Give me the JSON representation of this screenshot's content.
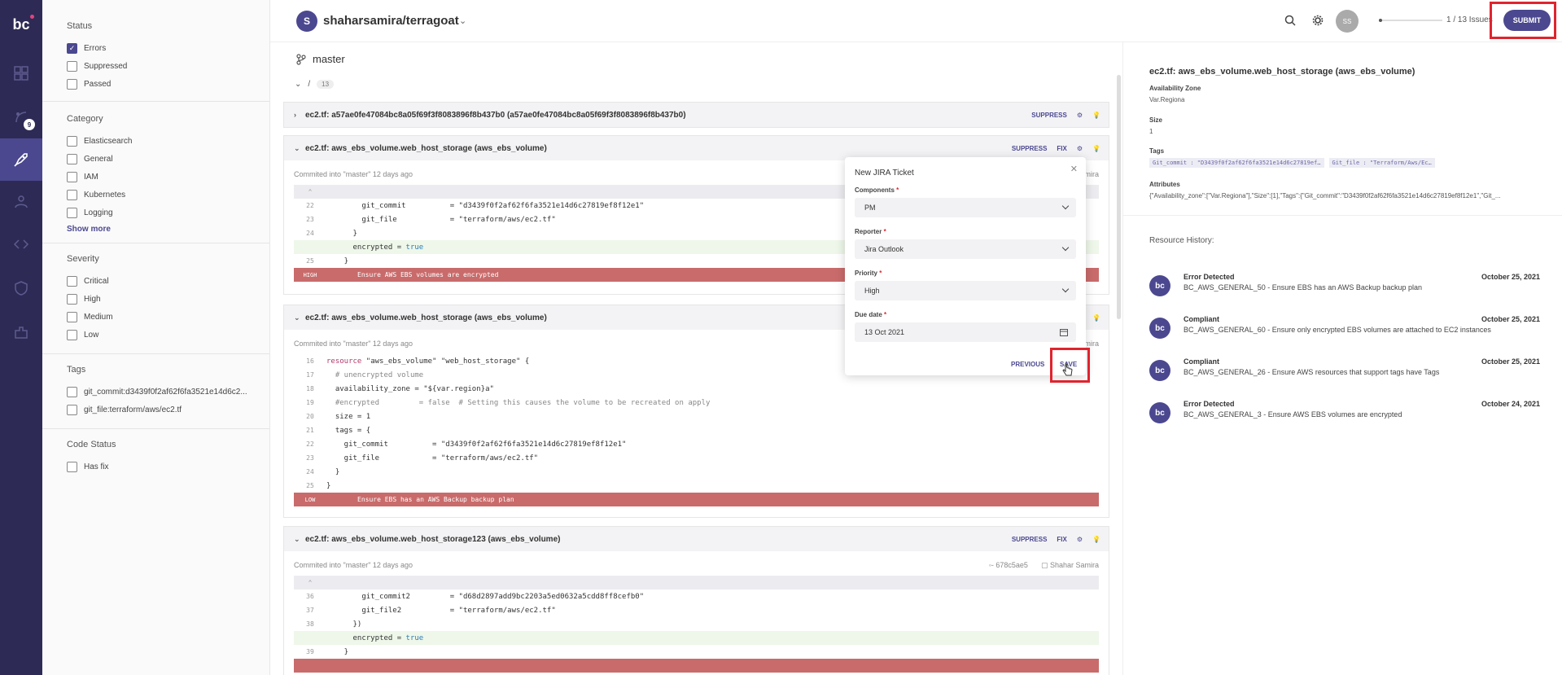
{
  "rail": {
    "logo": "bc",
    "badge_count": "9"
  },
  "filters": {
    "status": {
      "title": "Status",
      "items": [
        {
          "label": "Errors",
          "checked": true
        },
        {
          "label": "Suppressed",
          "checked": false
        },
        {
          "label": "Passed",
          "checked": false
        }
      ]
    },
    "category": {
      "title": "Category",
      "items": [
        "Elasticsearch",
        "General",
        "IAM",
        "Kubernetes",
        "Logging"
      ],
      "show_more": "Show more"
    },
    "severity": {
      "title": "Severity",
      "items": [
        "Critical",
        "High",
        "Medium",
        "Low"
      ]
    },
    "tags": {
      "title": "Tags",
      "items": [
        "git_commit:d3439f0f2af62f6fa3521e14d6c2...",
        "git_file:terraform/aws/ec2.tf"
      ]
    },
    "code_status": {
      "title": "Code Status",
      "items": [
        "Has fix"
      ]
    }
  },
  "topbar": {
    "repo_initial": "S",
    "repo_name": "shaharsamira/terragoat",
    "user_initials": "SS",
    "progress_fraction": 0.05,
    "issue_count": "1 / 13 Issues",
    "submit_label": "SUBMIT"
  },
  "main": {
    "branch": "master",
    "path_sep": "/",
    "path_count": "13",
    "blocks": [
      {
        "title": "ec2.tf: a57ae0fe47084bc8a05f69f3f8083896f8b437b0 (a57ae0fe47084bc8a05f69f3f8083896f8b437b0)",
        "suppress": "SUPPRESS"
      },
      {
        "title": "ec2.tf: aws_ebs_volume.web_host_storage (aws_ebs_volume)",
        "suppress": "SUPPRESS",
        "fix": "FIX",
        "commit": "Commited into \"master\" 12 days ago",
        "truncated_meta": "mira",
        "lines": [
          {
            "n": "22",
            "t": "        git_commit          = \"d3439f0f2af62f6fa3521e14d6c27819ef8f12e1\""
          },
          {
            "n": "23",
            "t": "        git_file            = \"terraform/aws/ec2.tf\""
          },
          {
            "n": "24",
            "t": "      }"
          },
          {
            "n": "",
            "t": "      encrypted = ",
            "v": "true"
          },
          {
            "n": "25",
            "t": "    }"
          }
        ],
        "severity": "HIGH",
        "message": "Ensure AWS EBS volumes are encrypted"
      },
      {
        "title": "ec2.tf: aws_ebs_volume.web_host_storage (aws_ebs_volume)",
        "commit": "Commited into \"master\" 12 days ago",
        "truncated_meta": "mira",
        "lines": [
          {
            "n": "16",
            "kw": "resource",
            "t": " \"aws_ebs_volume\" \"web_host_storage\" {"
          },
          {
            "n": "17",
            "cm": "  # unencrypted volume"
          },
          {
            "n": "18",
            "t": "  availability_zone = \"${var.region}a\""
          },
          {
            "n": "19",
            "cm": "  #encrypted         = false  # Setting this causes the volume to be recreated on apply"
          },
          {
            "n": "20",
            "t": "  size = 1"
          },
          {
            "n": "21",
            "t": "  tags = {"
          },
          {
            "n": "22",
            "t": "    git_commit          = \"d3439f0f2af62f6fa3521e14d6c27819ef8f12e1\""
          },
          {
            "n": "23",
            "t": "    git_file            = \"terraform/aws/ec2.tf\""
          },
          {
            "n": "24",
            "t": "  }"
          },
          {
            "n": "25",
            "t": "}"
          }
        ],
        "severity": "LOW",
        "message": "Ensure EBS has an AWS Backup backup plan"
      },
      {
        "title": "ec2.tf: aws_ebs_volume.web_host_storage123 (aws_ebs_volume)",
        "suppress": "SUPPRESS",
        "fix": "FIX",
        "commit": "Commited into \"master\" 12 days ago",
        "hash": "678c5ae5",
        "author": "Shahar Samira",
        "lines": [
          {
            "n": "36",
            "t": "        git_commit2         = \"d68d2897add9bc2203a5ed0632a5cdd8ff8cefb0\""
          },
          {
            "n": "37",
            "t": "        git_file2           = \"terraform/aws/ec2.tf\""
          },
          {
            "n": "38",
            "t": "      })"
          },
          {
            "n": "",
            "t": "      encrypted = ",
            "v": "true"
          },
          {
            "n": "39",
            "t": "    }"
          }
        ]
      }
    ]
  },
  "jira": {
    "title": "New JIRA Ticket",
    "components_label": "Components",
    "components_value": "PM",
    "reporter_label": "Reporter",
    "reporter_value": "Jira Outlook",
    "priority_label": "Priority",
    "priority_value": "High",
    "due_label": "Due date",
    "due_value": "13 Oct 2021",
    "required_mark": "*",
    "previous_label": "PREVIOUS",
    "save_label": "SAVE"
  },
  "resource": {
    "title": "ec2.tf: aws_ebs_volume.web_host_storage (aws_ebs_volume)",
    "az_label": "Availability Zone",
    "az_value": "Var.Regiona",
    "size_label": "Size",
    "size_value": "1",
    "tags_label": "Tags",
    "tag1": "Git_commit : \"D3439f0f2af62f6fa3521e14d6c27819ef…",
    "tag2": "Git_file : \"Terraform/Aws/Ec…",
    "attr_label": "Attributes",
    "attr_value": "{\"Availability_zone\":[\"Var.Regiona\"],\"Size\":[1],\"Tags\":{\"Git_commit\":\"D3439f0f2af62f6fa3521e14d6c27819ef8f12e1\",\"Git_...",
    "history_title": "Resource History:",
    "history": [
      {
        "title": "Error Detected",
        "date": "October 25, 2021",
        "msg": "BC_AWS_GENERAL_50 - Ensure EBS has an AWS Backup backup plan"
      },
      {
        "title": "Compliant",
        "date": "October 25, 2021",
        "msg": "BC_AWS_GENERAL_60 - Ensure only encrypted EBS volumes are attached to EC2 instances"
      },
      {
        "title": "Compliant",
        "date": "October 25, 2021",
        "msg": "BC_AWS_GENERAL_26 - Ensure AWS resources that support tags have Tags"
      },
      {
        "title": "Error Detected",
        "date": "October 24, 2021",
        "msg": "BC_AWS_GENERAL_3 - Ensure AWS EBS volumes are encrypted"
      }
    ],
    "history_avatar": "bc"
  },
  "colors": {
    "accent": "#4b4890",
    "rail": "#2d2b55",
    "severity_bar": "#c96b6b",
    "highlight": "#e0242e"
  }
}
